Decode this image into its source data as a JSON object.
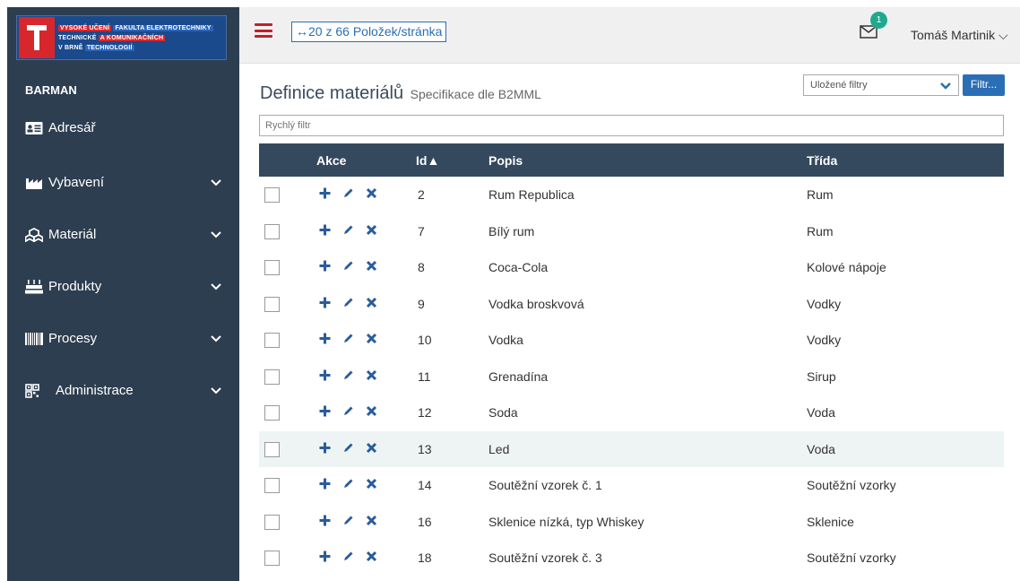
{
  "logo": {
    "line1a": "VYSOKÉ UČENÍ",
    "line1b": "FAKULTA ELEKTROTECHNIKY",
    "line2a": "TECHNICKÉ",
    "line2b": "A KOMUNIKAČNÍCH",
    "line3a": "V BRNĚ",
    "line3b": "TECHNOLOGIÍ"
  },
  "sidebar": {
    "app_name": "BARMAN",
    "items": [
      {
        "label": "Adresář",
        "icon": "address-card-icon"
      },
      {
        "label": "Vybavení",
        "icon": "industry-icon"
      },
      {
        "label": "Materiál",
        "icon": "cubes-icon"
      },
      {
        "label": "Produkty",
        "icon": "birthday-cake-icon"
      },
      {
        "label": "Procesy",
        "icon": "barcode-icon"
      },
      {
        "label": "Administrace",
        "icon": "qrcode-icon"
      }
    ]
  },
  "topbar": {
    "pager_label": "↔20 z 66 Položek/stránka",
    "notification_count": "1",
    "user_name": "Tomáš Martinik ⌵"
  },
  "page": {
    "title": "Definice materiálů",
    "subtitle": "Specifikace dle B2MML",
    "saved_filters_placeholder": "Uložené filtry",
    "filter_button": "Filtr...",
    "quick_filter_placeholder": "Rychlý filtr"
  },
  "table": {
    "headers": {
      "actions": "Akce",
      "id": "Id▲",
      "desc": "Popis",
      "class": "Třída"
    },
    "rows": [
      {
        "id": "2",
        "desc": "Rum Republica",
        "class": "Rum"
      },
      {
        "id": "7",
        "desc": "Bílý rum",
        "class": "Rum"
      },
      {
        "id": "8",
        "desc": "Coca-Cola",
        "class": "Kolové nápoje"
      },
      {
        "id": "9",
        "desc": "Vodka broskvová",
        "class": "Vodky"
      },
      {
        "id": "10",
        "desc": "Vodka",
        "class": "Vodky"
      },
      {
        "id": "11",
        "desc": "Grenadína",
        "class": "Sirup"
      },
      {
        "id": "12",
        "desc": "Soda",
        "class": "Voda"
      },
      {
        "id": "13",
        "desc": "Led",
        "class": "Voda"
      },
      {
        "id": "14",
        "desc": "Soutěžní vzorek č. 1",
        "class": "Soutěžní vzorky"
      },
      {
        "id": "16",
        "desc": "Sklenice nízká, typ Whiskey",
        "class": "Sklenice"
      },
      {
        "id": "18",
        "desc": "Soutěžní vzorek č. 3",
        "class": "Soutěžní vzorky"
      }
    ]
  },
  "colors": {
    "sidebar_bg": "#2d3e50",
    "table_header_bg": "#34495e",
    "accent_blue": "#2a6fb5",
    "action_icon": "#2a5c9a",
    "badge": "#1faa8f",
    "hamburger": "#c0202a"
  }
}
